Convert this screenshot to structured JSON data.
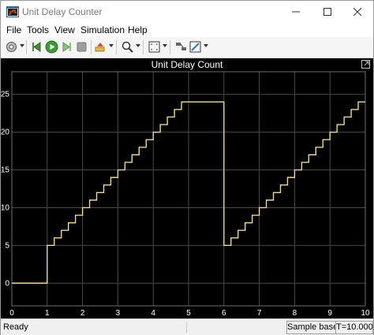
{
  "window": {
    "title": "Unit Delay Counter",
    "icons": {
      "app": "simulink-scope-icon",
      "minimize": "minimize-icon",
      "maximize": "maximize-icon",
      "close": "close-icon"
    }
  },
  "menu": [
    "File",
    "Tools",
    "View",
    "Simulation",
    "Help"
  ],
  "toolbar": {
    "icons": [
      "settings-icon",
      "step-back-icon",
      "run-icon",
      "step-forward-icon",
      "stop-icon",
      "highlight-icon",
      "zoom-icon",
      "fit-axes-icon",
      "cursor-icon",
      "style-icon"
    ]
  },
  "plot": {
    "title": "Unit Delay Count",
    "colors": {
      "background": "#000000",
      "grid": "#4a4a4a",
      "axes": "#6e6e6e",
      "tick_text": "#ffffff",
      "signal": "#ebd79b"
    }
  },
  "status": {
    "left": "Ready",
    "sample": "Sample based",
    "time": "T=10.000"
  },
  "chart_data": {
    "type": "line",
    "title": "Unit Delay Count",
    "xlabel": "",
    "ylabel": "",
    "xlim": [
      0,
      10
    ],
    "ylim": [
      -3,
      28
    ],
    "x_ticks": [
      0,
      1,
      2,
      3,
      4,
      5,
      6,
      7,
      8,
      9,
      10
    ],
    "y_ticks": [
      0,
      5,
      10,
      15,
      20,
      25
    ],
    "grid": true,
    "series": [
      {
        "step": true,
        "x": [
          0,
          1,
          1.2,
          1.4,
          1.6,
          1.8,
          2.0,
          2.2,
          2.4,
          2.6,
          2.8,
          3.0,
          3.2,
          3.4,
          3.6,
          3.8,
          4.0,
          4.2,
          4.4,
          4.6,
          4.8,
          6.0,
          6.2,
          6.4,
          6.6,
          6.8,
          7.0,
          7.2,
          7.4,
          7.6,
          7.8,
          8.0,
          8.2,
          8.4,
          8.6,
          8.8,
          9.0,
          9.2,
          9.4,
          9.6,
          9.8,
          10.0
        ],
        "y": [
          0,
          5,
          6,
          7,
          8,
          9,
          10,
          11,
          12,
          13,
          14,
          15,
          16,
          17,
          18,
          19,
          20,
          21,
          22,
          23,
          24,
          5,
          6,
          7,
          8,
          9,
          10,
          11,
          12,
          13,
          14,
          15,
          16,
          17,
          18,
          19,
          20,
          21,
          22,
          23,
          24,
          24
        ]
      }
    ]
  }
}
